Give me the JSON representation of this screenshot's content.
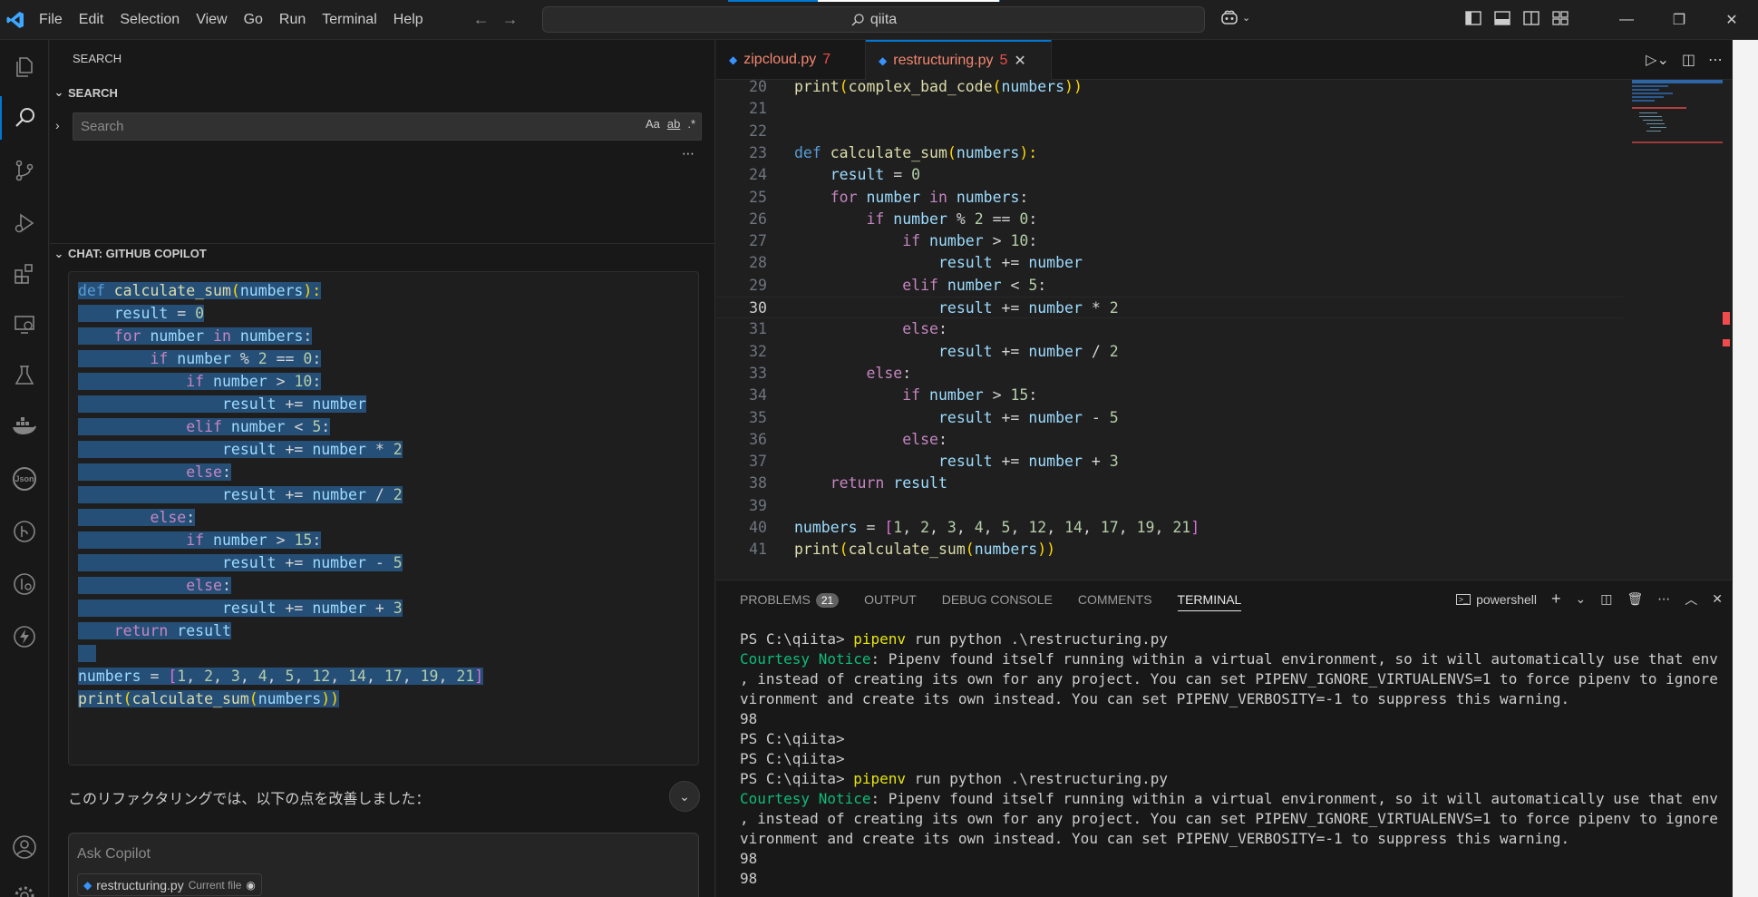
{
  "titlebar": {
    "menu": [
      "File",
      "Edit",
      "Selection",
      "View",
      "Go",
      "Run",
      "Terminal",
      "Help"
    ],
    "search_text": "qiita"
  },
  "sidebar": {
    "header": "SEARCH",
    "search_section": "SEARCH",
    "search_placeholder": "Search",
    "search_opts": [
      "Aa",
      "ab",
      ".*"
    ],
    "chat_section": "CHAT: GITHUB COPILOT",
    "chat_note": "このリファクタリングでは、以下の点を改善しました：",
    "ask_placeholder": "Ask Copilot",
    "file_chip": "restructuring.py",
    "file_chip_sub": "Current file",
    "chat_code": [
      "def calculate_sum(numbers):",
      "    result = 0",
      "    for number in numbers:",
      "        if number % 2 == 0:",
      "            if number > 10:",
      "                result += number",
      "            elif number < 5:",
      "                result += number * 2",
      "            else:",
      "                result += number / 2",
      "        else:",
      "            if number > 15:",
      "                result += number - 5",
      "            else:",
      "                result += number + 3",
      "    return result",
      "",
      "numbers = [1, 2, 3, 4, 5, 12, 14, 17, 19, 21]",
      "print(calculate_sum(numbers))"
    ]
  },
  "editor": {
    "tabs": [
      {
        "name": "zipcloud.py",
        "count": "7"
      },
      {
        "name": "restructuring.py",
        "count": "5"
      }
    ],
    "lines": [
      {
        "n": "20",
        "text": "print(complex_bad_code(numbers))"
      },
      {
        "n": "21",
        "text": ""
      },
      {
        "n": "22",
        "text": ""
      },
      {
        "n": "23",
        "text": "def calculate_sum(numbers):"
      },
      {
        "n": "24",
        "text": "    result = 0"
      },
      {
        "n": "25",
        "text": "    for number in numbers:"
      },
      {
        "n": "26",
        "text": "        if number % 2 == 0:"
      },
      {
        "n": "27",
        "text": "            if number > 10:"
      },
      {
        "n": "28",
        "text": "                result += number"
      },
      {
        "n": "29",
        "text": "            elif number < 5:"
      },
      {
        "n": "30",
        "text": "                result += number * 2"
      },
      {
        "n": "31",
        "text": "            else:"
      },
      {
        "n": "32",
        "text": "                result += number / 2"
      },
      {
        "n": "33",
        "text": "        else:"
      },
      {
        "n": "34",
        "text": "            if number > 15:"
      },
      {
        "n": "35",
        "text": "                result += number - 5"
      },
      {
        "n": "36",
        "text": "            else:"
      },
      {
        "n": "37",
        "text": "                result += number + 3"
      },
      {
        "n": "38",
        "text": "    return result"
      },
      {
        "n": "39",
        "text": ""
      },
      {
        "n": "40",
        "text": "numbers = [1, 2, 3, 4, 5, 12, 14, 17, 19, 21]"
      },
      {
        "n": "41",
        "text": "print(calculate_sum(numbers))"
      }
    ],
    "current_line": "30"
  },
  "panel": {
    "tabs": [
      "PROBLEMS",
      "OUTPUT",
      "DEBUG CONSOLE",
      "COMMENTS",
      "TERMINAL"
    ],
    "problems_count": "21",
    "shell": "powershell",
    "terminal": [
      "PS C:\\qiita> pipenv run python .\\restructuring.py",
      "Courtesy Notice: Pipenv found itself running within a virtual environment, so it will automatically use that environment",
      ", instead of creating its own for any project. You can set PIPENV_IGNORE_VIRTUALENVS=1 to force pipenv to ignore that en",
      "vironment and create its own instead. You can set PIPENV_VERBOSITY=-1 to suppress this warning.",
      "98",
      "PS C:\\qiita>",
      "PS C:\\qiita>",
      "PS C:\\qiita> pipenv run python .\\restructuring.py",
      "Courtesy Notice: Pipenv found itself running within a virtual environment, so it will automatically use that environment",
      ", instead of creating its own for any project. You can set PIPENV_IGNORE_VIRTUALENVS=1 to force pipenv to ignore that en",
      "vironment and create its own instead. You can set PIPENV_VERBOSITY=-1 to suppress this warning.",
      "98",
      "98"
    ]
  },
  "colors": {
    "accent": "#0078d4",
    "error": "#f14c4c",
    "selection": "#264f78"
  }
}
